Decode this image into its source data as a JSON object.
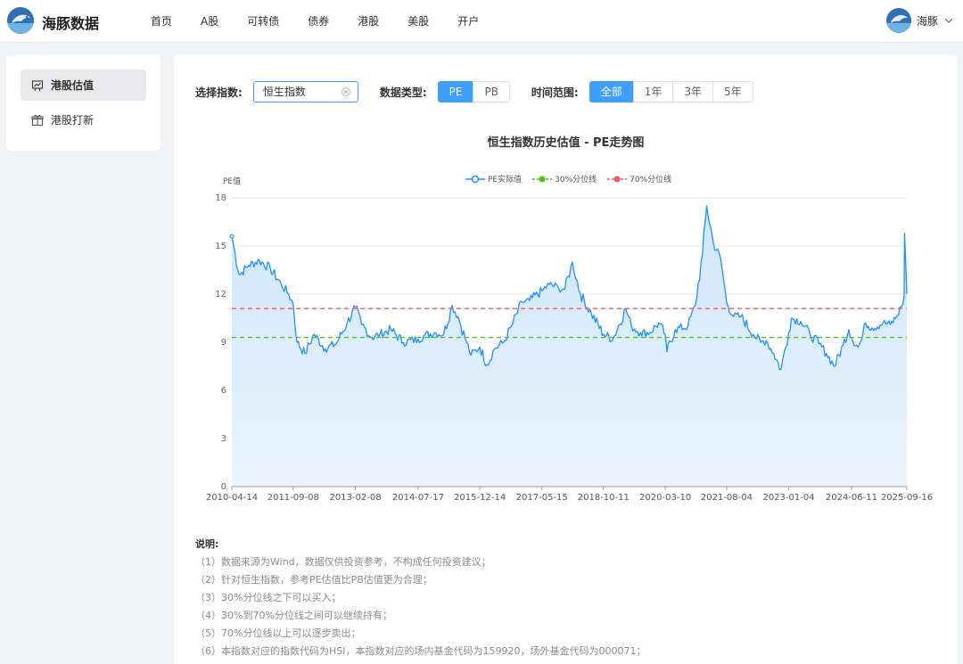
{
  "brand": {
    "name": "海豚数据"
  },
  "nav": [
    {
      "label": "首页"
    },
    {
      "label": "A股"
    },
    {
      "label": "可转债"
    },
    {
      "label": "债券"
    },
    {
      "label": "港股"
    },
    {
      "label": "美股"
    },
    {
      "label": "开户"
    }
  ],
  "user": {
    "name": "海豚"
  },
  "sidebar": {
    "items": [
      {
        "label": "港股估值",
        "icon": "chart-board-icon",
        "active": true
      },
      {
        "label": "港股打新",
        "icon": "gift-icon",
        "active": false
      }
    ]
  },
  "filters": {
    "index_label": "选择指数:",
    "index_value": "恒生指数",
    "type_label": "数据类型:",
    "types": [
      "PE",
      "PB"
    ],
    "type_selected": "PE",
    "range_label": "时间范围:",
    "ranges": [
      "全部",
      "1年",
      "3年",
      "5年"
    ],
    "range_selected": "全部"
  },
  "colors": {
    "accent": "#409eff",
    "pe_line": "#1e90ff",
    "p30": "#52c41a",
    "p70": "#f5555b"
  },
  "chart_data": {
    "type": "area",
    "title": "恒生指数历史估值 - PE走势图",
    "ylabel": "PE值",
    "ylim": [
      0,
      18
    ],
    "yticks": [
      "0",
      "3",
      "6",
      "9",
      "12",
      "15",
      "18"
    ],
    "xticks": [
      "2010-04-14",
      "2011-09-08",
      "2013-02-08",
      "2014-07-17",
      "2015-12-14",
      "2017-05-15",
      "2018-10-11",
      "2020-03-10",
      "2021-08-04",
      "2023-01-04",
      "2024-06-11",
      "2025-09-16"
    ],
    "legend": [
      "PE实际值",
      "30%分位线",
      "70%分位线"
    ],
    "legend_position": "top",
    "grid": true,
    "percentile_30": 9.3,
    "percentile_70": 11.1,
    "series": [
      {
        "name": "PE实际值",
        "x": [
          "2010-04-14",
          "2010-06-15",
          "2010-09-01",
          "2010-12-01",
          "2011-03-01",
          "2011-06-01",
          "2011-08-01",
          "2011-09-08",
          "2011-10-10",
          "2011-12-15",
          "2012-03-01",
          "2012-06-01",
          "2012-09-01",
          "2012-12-01",
          "2013-02-08",
          "2013-04-01",
          "2013-06-25",
          "2013-09-01",
          "2013-12-01",
          "2014-03-15",
          "2014-07-17",
          "2014-09-01",
          "2014-12-01",
          "2015-02-15",
          "2015-04-27",
          "2015-06-15",
          "2015-08-25",
          "2015-10-01",
          "2015-12-14",
          "2016-02-11",
          "2016-04-15",
          "2016-07-01",
          "2016-09-15",
          "2016-12-01",
          "2017-02-01",
          "2017-05-15",
          "2017-07-15",
          "2017-09-30",
          "2017-11-22",
          "2018-01-26",
          "2018-04-01",
          "2018-07-01",
          "2018-10-11",
          "2018-12-28",
          "2019-04-15",
          "2019-06-01",
          "2019-08-15",
          "2019-11-01",
          "2020-01-15",
          "2020-03-10",
          "2020-03-23",
          "2020-06-01",
          "2020-09-15",
          "2020-11-15",
          "2021-01-15",
          "2021-02-18",
          "2021-04-15",
          "2021-06-15",
          "2021-08-04",
          "2021-10-01",
          "2021-12-01",
          "2022-03-15",
          "2022-05-15",
          "2022-07-01",
          "2022-09-01",
          "2022-10-31",
          "2023-01-04",
          "2023-01-27",
          "2023-04-15",
          "2023-07-01",
          "2023-09-15",
          "2023-11-15",
          "2024-01-22",
          "2024-04-01",
          "2024-05-20",
          "2024-06-11",
          "2024-08-05",
          "2024-09-01",
          "2024-10-08",
          "2024-12-01",
          "2025-03-01",
          "2025-05-01",
          "2025-06-15",
          "2025-08-01",
          "2025-08-25",
          "2025-08-28",
          "2025-09-16"
        ],
        "values": [
          15.6,
          13.2,
          13.8,
          14.1,
          13.6,
          12.6,
          12.0,
          11.4,
          9.0,
          8.3,
          9.5,
          8.6,
          8.9,
          10.2,
          11.2,
          10.1,
          9.3,
          9.5,
          9.8,
          9.0,
          9.2,
          9.4,
          9.6,
          9.5,
          11.3,
          10.6,
          9.0,
          8.2,
          8.7,
          7.6,
          8.6,
          9.0,
          10.2,
          11.5,
          11.6,
          12.2,
          12.6,
          12.4,
          12.3,
          14.0,
          12.0,
          10.8,
          9.5,
          9.2,
          11.1,
          10.0,
          9.6,
          9.6,
          10.2,
          9.5,
          8.4,
          9.8,
          10.0,
          11.3,
          14.5,
          17.5,
          15.2,
          14.2,
          11.5,
          10.6,
          10.6,
          9.5,
          9.0,
          9.1,
          8.3,
          7.3,
          9.6,
          10.5,
          10.3,
          9.5,
          8.9,
          8.3,
          7.5,
          8.8,
          9.8,
          9.3,
          8.7,
          9.1,
          10.2,
          9.9,
          10.2,
          10.1,
          10.5,
          11.2,
          11.8,
          15.8,
          12.0
        ]
      }
    ]
  },
  "notes": {
    "title": "说明:",
    "items": [
      "（1）数据来源为Wind，数据仅供投资参考，不构成任何投资建议；",
      "（2）针对恒生指数，参考PE估值比PB估值更为合理；",
      "（3）30%分位线之下可以买入；",
      "（4）30%到70%分位线之间可以继续持有；",
      "（5）70%分位线以上可以逐步卖出；",
      "（6）本指数对应的指数代码为HSI，本指数对应的场内基金代码为159920，场外基金代码为000071；"
    ]
  }
}
